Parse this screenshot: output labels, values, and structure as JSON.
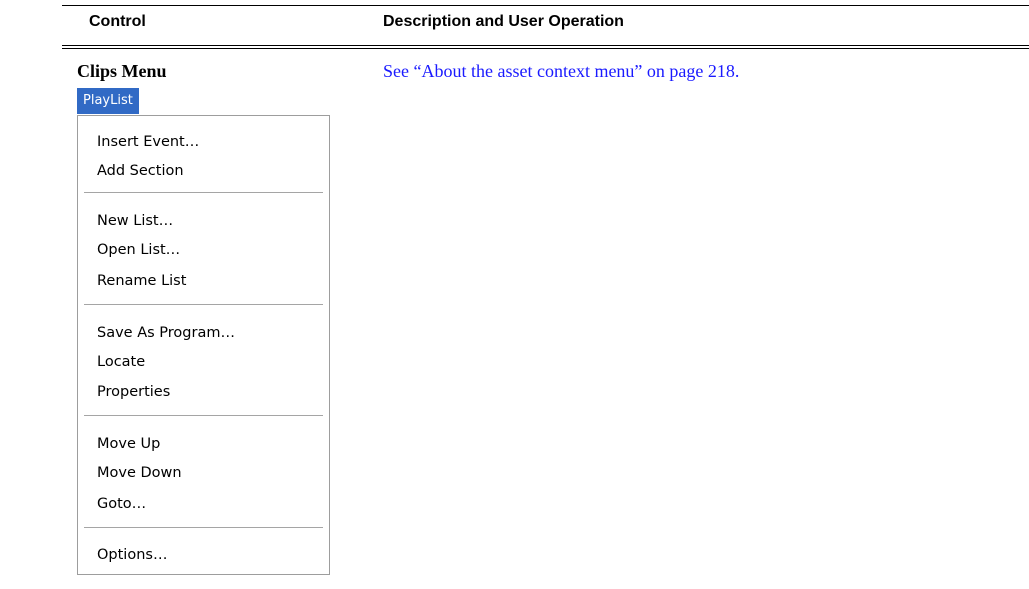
{
  "table": {
    "headers": {
      "control": "Control",
      "description": "Description and User Operation"
    },
    "row": {
      "control_title": "Clips Menu",
      "description_link": "See “About the asset context menu” on page 218."
    }
  },
  "menu": {
    "menubar_label": "PlayList",
    "items": [
      "Insert Event…",
      "Add Section",
      "New List…",
      "Open List…",
      "Rename List",
      "Save As Program…",
      "Locate",
      "Properties",
      "Move Up",
      "Move Down",
      "Goto…",
      "Options…"
    ]
  },
  "colors": {
    "menubar_highlight": "#316ac5",
    "link": "#1a1aff"
  }
}
